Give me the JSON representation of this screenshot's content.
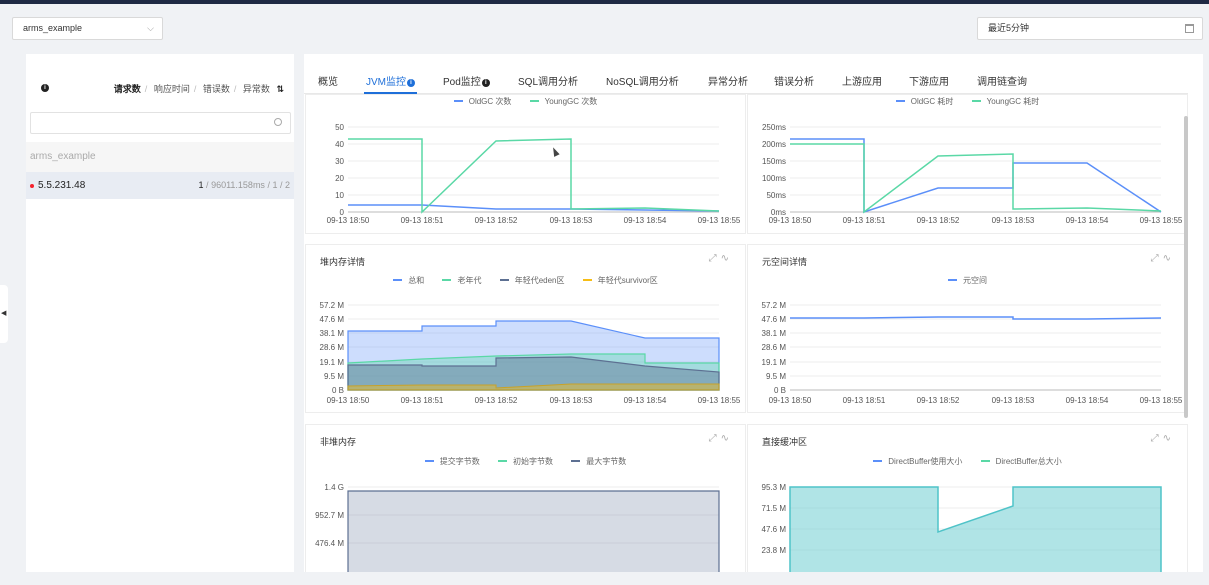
{
  "app": {
    "name": "arms_example",
    "time_range": "最近5分钟"
  },
  "left": {
    "sort_options": [
      "请求数",
      "响应时间",
      "错误数",
      "异常数"
    ],
    "active_sort": 0,
    "search_placeholder": "",
    "group_name": "arms_example",
    "host": {
      "ip": "5.5.231.48",
      "requests": "1",
      "rt": "96011.158ms",
      "errors": "1",
      "exceptions": "2"
    }
  },
  "tabs": [
    "概览",
    "JVM监控",
    "Pod监控",
    "SQL调用分析",
    "NoSQL调用分析",
    "异常分析",
    "错误分析",
    "上游应用",
    "下游应用",
    "调用链查询"
  ],
  "active_tab": 1,
  "x_ticks": [
    "09-13 18:50",
    "09-13 18:51",
    "09-13 18:52",
    "09-13 18:53",
    "09-13 18:54",
    "09-13 18:55"
  ],
  "panels": {
    "gc_count": {
      "legend": [
        "OldGC 次数",
        "YoungGC 次数"
      ],
      "yticks": [
        "0",
        "10",
        "20",
        "30",
        "40",
        "50"
      ]
    },
    "gc_time": {
      "legend": [
        "OldGC 耗时",
        "YoungGC 耗时"
      ],
      "yticks": [
        "0ms",
        "50ms",
        "100ms",
        "150ms",
        "200ms",
        "250ms"
      ]
    },
    "heap": {
      "title": "堆内存详情",
      "legend": [
        "总和",
        "老年代",
        "年轻代eden区",
        "年轻代survivor区"
      ],
      "yticks": [
        "0 B",
        "9.5 M",
        "19.1 M",
        "28.6 M",
        "38.1 M",
        "47.6 M",
        "57.2 M"
      ]
    },
    "metaspace": {
      "title": "元空间详情",
      "legend": [
        "元空间"
      ],
      "yticks": [
        "0 B",
        "9.5 M",
        "19.1 M",
        "28.6 M",
        "38.1 M",
        "47.6 M",
        "57.2 M"
      ]
    },
    "nonheap": {
      "title": "非堆内存",
      "legend": [
        "提交字节数",
        "初始字节数",
        "最大字节数"
      ],
      "yticks": [
        "476.4 M",
        "952.7 M",
        "1.4 G"
      ]
    },
    "direct": {
      "title": "直接缓冲区",
      "legend": [
        "DirectBuffer使用大小",
        "DirectBuffer总大小"
      ],
      "yticks": [
        "23.8 M",
        "47.6 M",
        "71.5 M",
        "95.3 M"
      ]
    }
  },
  "colors": {
    "blue": "#5b8ff9",
    "green": "#5ad8a6",
    "dark": "#5d7092",
    "yellow": "#f6bd16",
    "accent": "#1e6fd9",
    "teal": "#4fc3c8"
  },
  "chart_data": [
    {
      "type": "line",
      "legend": [
        "OldGC 次数",
        "YoungGC 次数"
      ],
      "x": [
        "09-13 18:50",
        "09-13 18:51",
        "09-13 18:52",
        "09-13 18:53",
        "09-13 18:54",
        "09-13 18:55"
      ],
      "ylim": [
        0,
        50
      ],
      "series": [
        {
          "name": "OldGC 次数",
          "values": [
            3,
            3,
            1.5,
            1.5,
            1,
            0.5
          ]
        },
        {
          "name": "YoungGC 次数",
          "values": [
            43,
            0,
            42,
            2,
            1.5,
            0.5
          ]
        }
      ]
    },
    {
      "type": "line",
      "legend": [
        "OldGC 耗时",
        "YoungGC 耗时"
      ],
      "x": [
        "09-13 18:50",
        "09-13 18:51",
        "09-13 18:52",
        "09-13 18:53",
        "09-13 18:54",
        "09-13 18:55"
      ],
      "ylim": [
        0,
        250
      ],
      "series": [
        {
          "name": "OldGC 耗时",
          "values": [
            215,
            0,
            70,
            140,
            140,
            0
          ]
        },
        {
          "name": "YoungGC 耗时",
          "values": [
            200,
            0,
            165,
            10,
            10,
            0
          ]
        }
      ]
    },
    {
      "type": "area",
      "title": "堆内存详情",
      "x": [
        "09-13 18:50",
        "09-13 18:51",
        "09-13 18:52",
        "09-13 18:53",
        "09-13 18:54",
        "09-13 18:55"
      ],
      "ylim": [
        0,
        57.2
      ],
      "series": [
        {
          "name": "总和",
          "values": [
            40,
            43,
            47,
            47,
            35,
            36
          ]
        },
        {
          "name": "老年代",
          "values": [
            18,
            21,
            23,
            24,
            24,
            18
          ]
        },
        {
          "name": "年轻代eden区",
          "values": [
            17,
            17,
            21,
            22,
            16,
            12
          ]
        },
        {
          "name": "年轻代survivor区",
          "values": [
            3,
            3,
            3,
            3,
            3,
            3
          ]
        }
      ]
    },
    {
      "type": "line",
      "title": "元空间详情",
      "x": [
        "09-13 18:50",
        "09-13 18:51",
        "09-13 18:52",
        "09-13 18:53",
        "09-13 18:54",
        "09-13 18:55"
      ],
      "ylim": [
        0,
        57.2
      ],
      "series": [
        {
          "name": "元空间",
          "values": [
            48,
            48,
            48,
            47,
            47,
            47
          ]
        }
      ]
    },
    {
      "type": "area",
      "title": "非堆内存",
      "x": [
        "09-13 18:50",
        "09-13 18:55"
      ],
      "ylim": [
        0,
        1.6
      ],
      "series": [
        {
          "name": "提交字节数",
          "values": [
            1.4,
            1.4
          ]
        }
      ]
    },
    {
      "type": "area",
      "title": "直接缓冲区",
      "x": [
        "09-13 18:50",
        "09-13 18:52",
        "09-13 18:53",
        "09-13 18:55"
      ],
      "ylim": [
        0,
        100
      ],
      "series": [
        {
          "name": "DirectBuffer使用大小",
          "values": [
            95.3,
            95.3,
            95.3,
            95.3
          ]
        },
        {
          "name": "DirectBuffer总大小",
          "values": [
            95.3,
            45,
            72,
            95.3
          ]
        }
      ]
    }
  ]
}
